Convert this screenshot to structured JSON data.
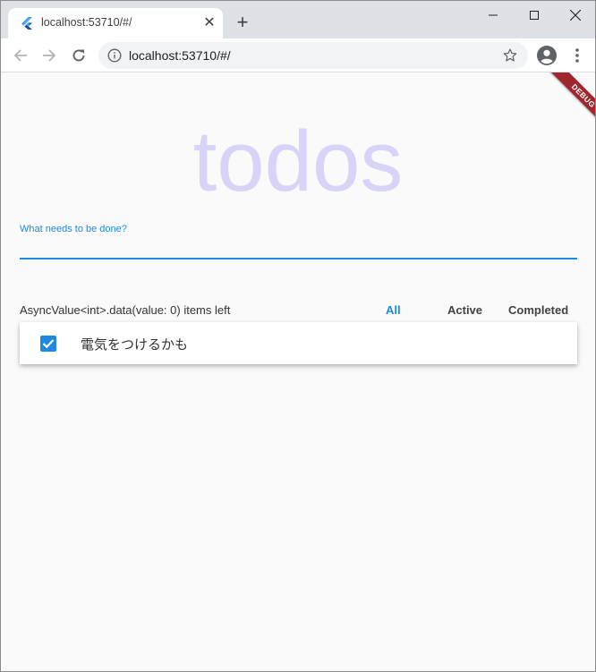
{
  "browser": {
    "tab": {
      "title": "localhost:53710/#/",
      "favicon": "flutter-icon"
    },
    "address_bar": {
      "url": "localhost:53710/#/"
    },
    "icons": {
      "back": "arrow-left-icon",
      "forward": "arrow-right-icon",
      "reload": "reload-icon",
      "info": "info-icon",
      "bookmark": "star-icon",
      "profile": "account-icon",
      "menu": "vertical-dots-icon"
    }
  },
  "app": {
    "debug_banner": "DEBUG",
    "title": "todos",
    "new_todo_label": "What needs to be done?",
    "new_todo_value": "",
    "items_left_text": "AsyncValue<int>.data(value: 0) items left",
    "filters": [
      {
        "label": "All",
        "selected": true
      },
      {
        "label": "Active",
        "selected": false
      },
      {
        "label": "Completed",
        "selected": false
      }
    ],
    "todos": [
      {
        "text": "電気をつけるかも",
        "completed": true
      }
    ]
  },
  "colors": {
    "accent": "#1e88e5",
    "title": "#5b4ff0",
    "debug_banner": "#a1252d",
    "tabstrip": "#dee1e6"
  }
}
